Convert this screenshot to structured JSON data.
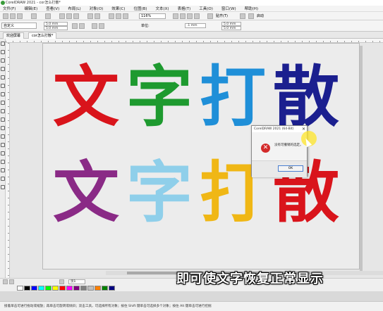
{
  "window": {
    "title": "CorelDRAW 2021 - cor怎么打散*"
  },
  "menu": {
    "items": [
      "文件(F)",
      "编辑(E)",
      "查看(V)",
      "布局(L)",
      "对象(O)",
      "效果(C)",
      "位图(B)",
      "文本(X)",
      "表格(T)",
      "工具(O)",
      "窗口(W)",
      "帮助(H)"
    ]
  },
  "toolbar": {
    "zoom": "116%",
    "snap_label": "贴齐(T)",
    "launch_label": "启动"
  },
  "propbar": {
    "paper_select": "自定义",
    "nudge": ".1 mm",
    "width": "5.0 mm",
    "height": "5.0 mm",
    "dup_x": "5.0 mm",
    "dup_y": "5.0 mm",
    "units_label": "单位:"
  },
  "doc_tabs": [
    {
      "label": "欢迎屏幕"
    },
    {
      "label": "cor怎么打散*"
    }
  ],
  "artwork": {
    "row1": [
      {
        "char": "文",
        "color": "#d9141b"
      },
      {
        "char": "字",
        "color": "#1e9a2f"
      },
      {
        "char": "打",
        "color": "#1f8fd8"
      },
      {
        "char": "散",
        "color": "#1b1f8f"
      }
    ],
    "row2": [
      {
        "char": "文",
        "color": "#8a2a86"
      },
      {
        "char": "字",
        "color": "#8fcfea"
      },
      {
        "char": "打",
        "color": "#f0b715"
      },
      {
        "char": "散",
        "color": "#d9141b"
      }
    ]
  },
  "dialog": {
    "title": "CorelDRAW 2021 (64-Bit)",
    "message": "没有可撤销的选定。",
    "ok_label": "OK"
  },
  "pagenav": {
    "page_label": "页1"
  },
  "palette": {
    "colors": [
      "#ffffff",
      "#000000",
      "#0000ff",
      "#00ffff",
      "#00ff00",
      "#ffff00",
      "#ff0000",
      "#ff00ff",
      "#800080",
      "#808080",
      "#c0c0c0",
      "#ff8000",
      "#008000",
      "#000080"
    ]
  },
  "statusbar": {
    "text": "接着单击可进行拖动或缩放；再单击可旋转或倾斜；双击工具，可选择所有对象；按住 Shift 键单击可选择多个对象；按住 Alt 键单击可进行挖掘"
  },
  "caption": {
    "text": "即可使文字恢复正常显示"
  }
}
